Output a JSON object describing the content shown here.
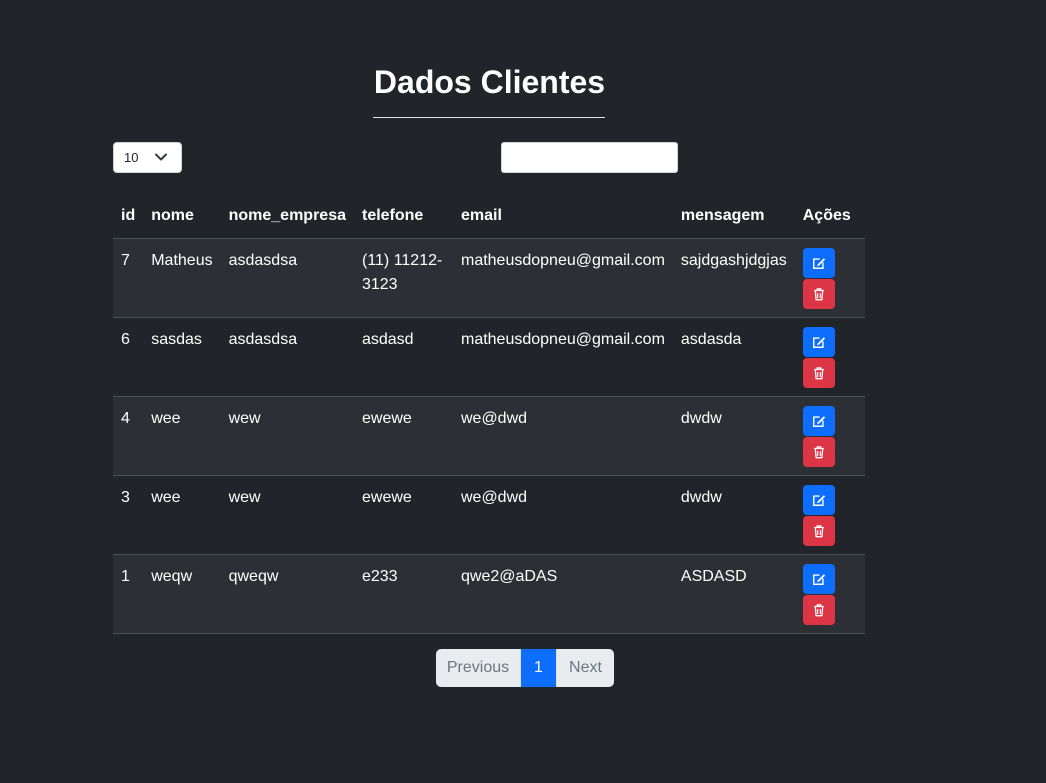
{
  "page": {
    "title": "Dados Clientes"
  },
  "controls": {
    "length_value": "10",
    "search_value": "",
    "search_placeholder": ""
  },
  "table": {
    "headers": [
      "id",
      "nome",
      "nome_empresa",
      "telefone",
      "email",
      "mensagem",
      "Ações"
    ],
    "rows": [
      {
        "id": "7",
        "nome": "Matheus",
        "nome_empresa": "asdasdsa",
        "telefone": "(11) 11212-3123",
        "email": "matheusdopneu@gmail.com",
        "mensagem": "sajdgashjdgjas"
      },
      {
        "id": "6",
        "nome": "sasdas",
        "nome_empresa": "asdasdsa",
        "telefone": "asdasd",
        "email": "matheusdopneu@gmail.com",
        "mensagem": "asdasda"
      },
      {
        "id": "4",
        "nome": "wee",
        "nome_empresa": "wew",
        "telefone": "ewewe",
        "email": "we@dwd",
        "mensagem": "dwdw"
      },
      {
        "id": "3",
        "nome": "wee",
        "nome_empresa": "wew",
        "telefone": "ewewe",
        "email": "we@dwd",
        "mensagem": "dwdw"
      },
      {
        "id": "1",
        "nome": "weqw",
        "nome_empresa": "qweqw",
        "telefone": "e233",
        "email": "qwe2@aDAS",
        "mensagem": "ASDASD"
      }
    ]
  },
  "pagination": {
    "previous_label": "Previous",
    "current_page": "1",
    "next_label": "Next"
  },
  "icons": {
    "length_dropdown": "chevron-down-icon",
    "edit": "pencil-square-icon",
    "delete": "trash-icon"
  },
  "colors": {
    "background": "#212529",
    "stripe": "#2c3034",
    "edit_button": "#0d6efd",
    "delete_button": "#dc3545",
    "pagination_active": "#0d6efd"
  }
}
